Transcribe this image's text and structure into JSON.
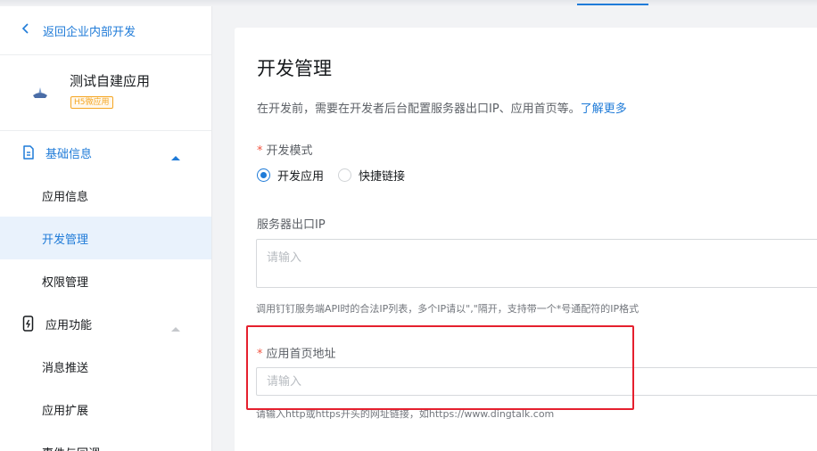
{
  "sidebar": {
    "back_label": "返回企业内部开发",
    "app": {
      "name": "测试自建应用",
      "badge": "H5微应用"
    },
    "groups": [
      {
        "label": "基础信息",
        "expanded": true,
        "icon": "document-icon",
        "items": [
          {
            "label": "应用信息",
            "active": false
          },
          {
            "label": "开发管理",
            "active": true
          },
          {
            "label": "权限管理",
            "active": false
          }
        ]
      },
      {
        "label": "应用功能",
        "expanded": true,
        "icon": "phone-lightning-icon",
        "items": [
          {
            "label": "消息推送",
            "active": false
          },
          {
            "label": "应用扩展",
            "active": false
          },
          {
            "label": "事件与回调",
            "active": false
          }
        ]
      }
    ]
  },
  "main": {
    "title": "开发管理",
    "description": "在开发前，需要在开发者后台配置服务器出口IP、应用首页等。",
    "learn_more": "了解更多",
    "dev_mode": {
      "label": "开发模式",
      "required": "*",
      "options": [
        {
          "label": "开发应用",
          "selected": true
        },
        {
          "label": "快捷链接",
          "selected": false
        }
      ]
    },
    "server_ip": {
      "label": "服务器出口IP",
      "placeholder": "请输入",
      "value": "",
      "helper": "调用钉钉服务端API时的合法IP列表，多个IP请以\",\"隔开，支持带一个*号通配符的IP格式"
    },
    "homepage_url": {
      "label": "应用首页地址",
      "required": "*",
      "placeholder": "请输入",
      "value": "",
      "helper": "请输入http或https开头的网址链接，如https://www.dingtalk.com"
    }
  },
  "colors": {
    "accent": "#1f7bd8",
    "required": "#f25643",
    "highlight": "#e5202e",
    "badge": "#f5a623"
  }
}
